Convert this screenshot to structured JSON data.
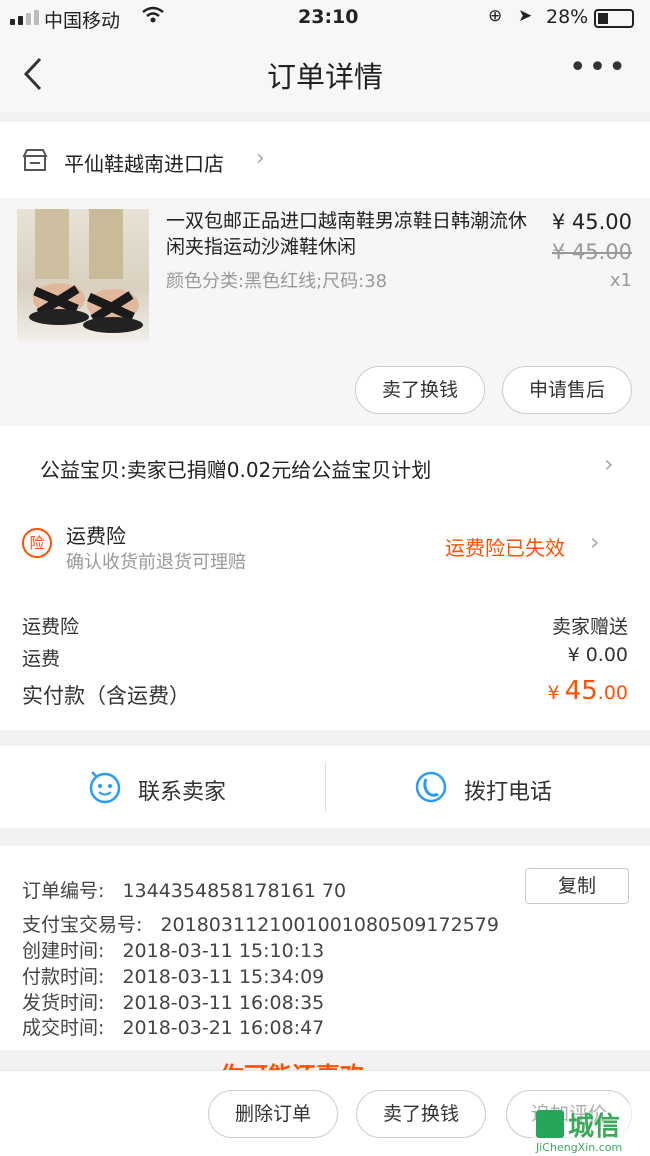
{
  "status": {
    "carrier": "中国移动",
    "time": "23:10",
    "battery": "28%"
  },
  "nav": {
    "title": "订单详情",
    "more_icon": "more-dots-icon"
  },
  "shop": {
    "name": "平仙鞋越南进口店"
  },
  "item": {
    "title": "一双包邮正品进口越南鞋男凉鞋日韩潮流休闲夹指运动沙滩鞋休闲",
    "spec": "颜色分类:黑色红线;尺码:38",
    "price": "¥ 45.00",
    "orig_price": "¥ 45.00",
    "qty": "x1",
    "btn_sell": "卖了换钱",
    "btn_aftersale": "申请售后"
  },
  "charity": {
    "text": "公益宝贝:卖家已捐赠0.02元给公益宝贝计划"
  },
  "insurance": {
    "badge": "险",
    "title": "运费险",
    "subtitle": "确认收货前退货可理赔",
    "status": "运费险已失效"
  },
  "fees": [
    {
      "label": "运费险",
      "value": "卖家赠送"
    },
    {
      "label": "运费",
      "value": "¥ 0.00"
    }
  ],
  "total": {
    "label": "实付款（含运费）",
    "currency": "¥",
    "int": "45",
    "dec": ".00"
  },
  "contact": {
    "seller": "联系卖家",
    "phone": "拨打电话"
  },
  "order_info": {
    "copy_btn": "复制",
    "lines": [
      {
        "label": "订单编号:",
        "value": "1344354858178161 70"
      },
      {
        "label": "支付宝交易号:",
        "value": "2018031121001001080509172579"
      },
      {
        "label": "创建时间:",
        "value": "2018-03-11 15:10:13"
      },
      {
        "label": "付款时间:",
        "value": "2018-03-11 15:34:09"
      },
      {
        "label": "发货时间:",
        "value": "2018-03-11 16:08:35"
      },
      {
        "label": "成交时间:",
        "value": "2018-03-21 16:08:47"
      }
    ]
  },
  "peek_text": "你可能还喜欢",
  "bottom": {
    "delete": "删除订单",
    "sell": "卖了换钱",
    "review": "追加评价"
  },
  "watermark": {
    "brand": "城信",
    "url": "JiChengXin.com"
  }
}
